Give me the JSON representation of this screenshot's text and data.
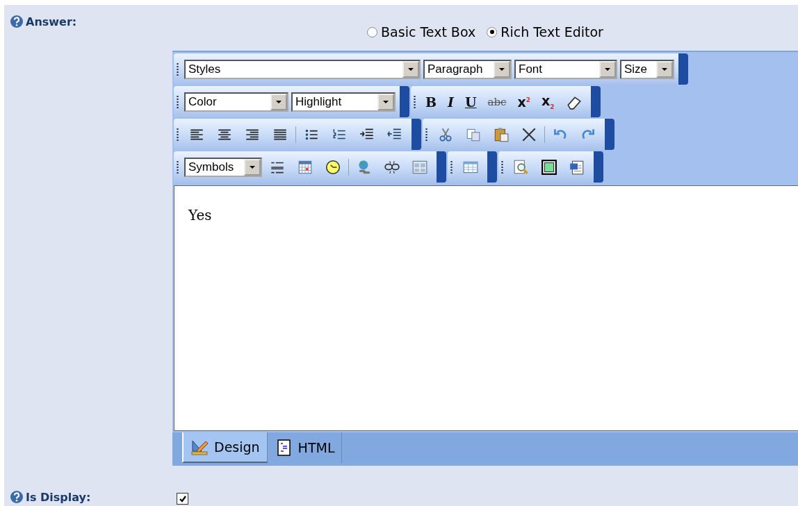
{
  "answer": {
    "label": "Answer:",
    "modes": [
      {
        "label": "Basic Text Box",
        "selected": false
      },
      {
        "label": "Rich Text Editor",
        "selected": true
      }
    ],
    "toolbar": {
      "dropdowns": [
        "Styles",
        "Paragraph",
        "Font",
        "Size",
        "Color",
        "Highlight",
        "Symbols"
      ],
      "format_buttons": [
        "B",
        "I",
        "U",
        "abc",
        "x$^{2}$",
        "x$_{2}$"
      ]
    },
    "content": "Yes",
    "tabs": [
      {
        "label": "Design",
        "selected": true
      },
      {
        "label": "HTML",
        "selected": false
      }
    ]
  },
  "is_display": {
    "label": "Is Display:",
    "checked": true
  }
}
